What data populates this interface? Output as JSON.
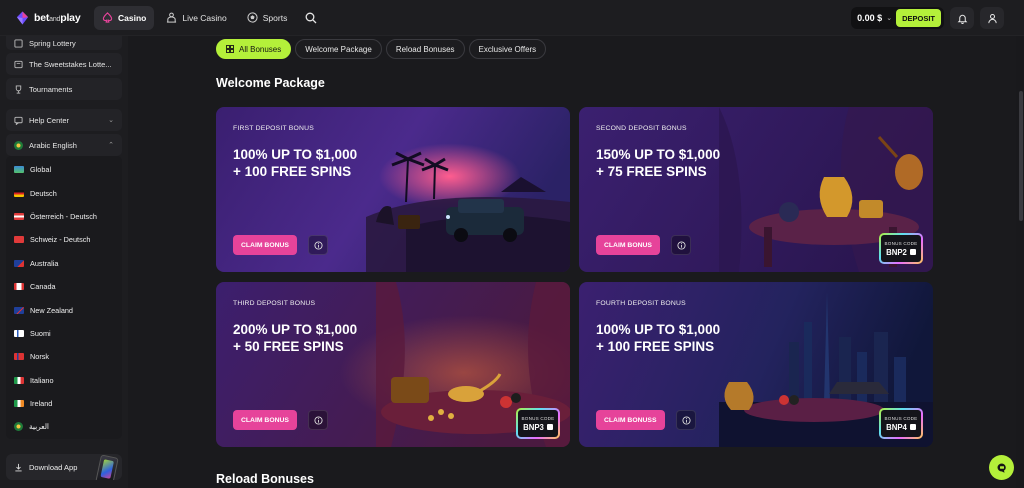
{
  "brand": {
    "name_part1": "bet",
    "name_part2": "and",
    "name_part3": "play"
  },
  "nav": {
    "items": [
      {
        "label": "Casino",
        "icon": "casino-icon"
      },
      {
        "label": "Live Casino",
        "icon": "live-casino-icon"
      },
      {
        "label": "Sports",
        "icon": "sports-icon"
      }
    ]
  },
  "header": {
    "balance": "0.00 $",
    "deposit_label": "DEPOSIT"
  },
  "sidebar": {
    "items": [
      {
        "label": "Spring Lottery"
      },
      {
        "label": "The Sweetstakes Lotte..."
      },
      {
        "label": "Tournaments"
      },
      {
        "label": "Help Center"
      },
      {
        "label": "Arabic English"
      }
    ],
    "languages": [
      {
        "label": "Global"
      },
      {
        "label": "Deutsch"
      },
      {
        "label": "Österreich - Deutsch"
      },
      {
        "label": "Schweiz - Deutsch"
      },
      {
        "label": "Australia"
      },
      {
        "label": "Canada"
      },
      {
        "label": "New Zealand"
      },
      {
        "label": "Suomi"
      },
      {
        "label": "Norsk"
      },
      {
        "label": "Italiano"
      },
      {
        "label": "Ireland"
      },
      {
        "label": "العربية"
      }
    ],
    "download_label": "Download App"
  },
  "filters": [
    {
      "label": "All Bonuses"
    },
    {
      "label": "Welcome Package"
    },
    {
      "label": "Reload Bonuses"
    },
    {
      "label": "Exclusive Offers"
    }
  ],
  "sections": {
    "welcome_title": "Welcome Package",
    "reload_title": "Reload Bonuses"
  },
  "cards": [
    {
      "label": "FIRST DEPOSIT BONUS",
      "headline": "100% UP TO $1,000\n+ 100 FREE SPINS",
      "cta": "CLAIM BONUS"
    },
    {
      "label": "SECOND DEPOSIT BONUS",
      "headline": "150% UP TO $1,000\n+ 75 FREE SPINS",
      "cta": "CLAIM BONUS",
      "code_label": "BONUS CODE",
      "code": "BNP2"
    },
    {
      "label": "THIRD DEPOSIT BONUS",
      "headline": "200% UP TO $1,000\n+ 50 FREE SPINS",
      "cta": "CLAIM BONUS",
      "code_label": "BONUS CODE",
      "code": "BNP3"
    },
    {
      "label": "FOURTH DEPOSIT BONUS",
      "headline": "100% UP TO $1,000\n+ 100 FREE SPINS",
      "cta": "CLAIM BONUSS",
      "code_label": "BONUS CODE",
      "code": "BNP4"
    }
  ],
  "colors": {
    "accent": "#b4f03a",
    "cta": "#e6439a",
    "background": "#1a1a1d",
    "card_purple": "#3a1f6b"
  }
}
